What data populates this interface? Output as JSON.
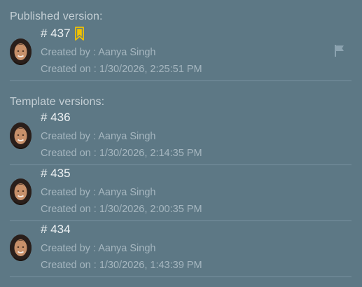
{
  "published": {
    "section_label": "Published version:",
    "version": {
      "number": "# 437",
      "created_by": "Created by : Aanya Singh",
      "created_on": "Created on : 1/30/2026, 2:25:51 PM"
    }
  },
  "templates": {
    "section_label": "Template versions:",
    "versions": [
      {
        "number": "# 436",
        "created_by": "Created by : Aanya Singh",
        "created_on": "Created on : 1/30/2026, 2:14:35 PM"
      },
      {
        "number": "# 435",
        "created_by": "Created by : Aanya Singh",
        "created_on": "Created on : 1/30/2026, 2:00:35 PM"
      },
      {
        "number": "# 434",
        "created_by": "Created by : Aanya Singh",
        "created_on": "Created on : 1/30/2026, 1:43:39 PM"
      }
    ]
  },
  "icons": {
    "published_marker": "bookmark-icon",
    "flag": "flag-icon"
  },
  "colors": {
    "background": "#5d7885",
    "bookmark": "#f2c200",
    "divider": "#7890a0"
  }
}
